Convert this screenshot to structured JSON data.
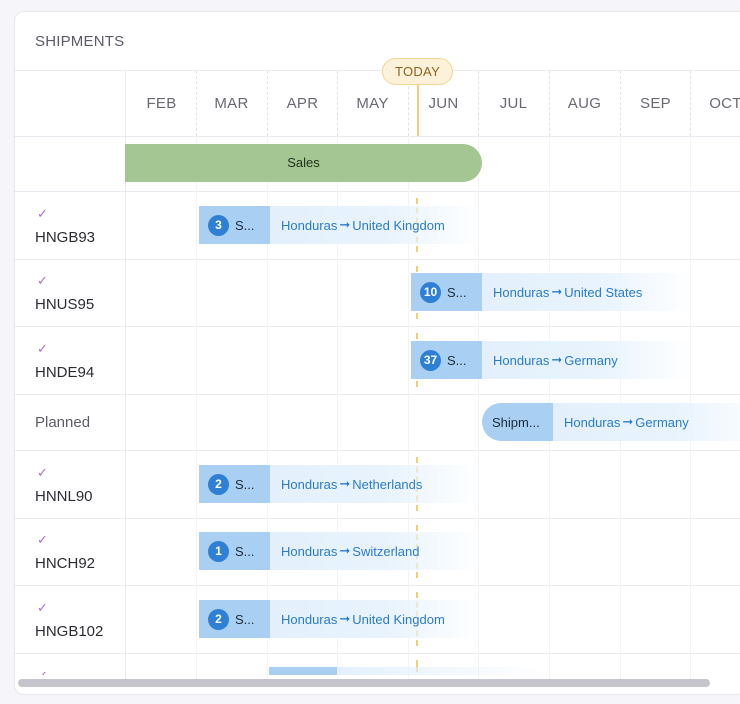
{
  "card": {
    "title": "SHIPMENTS"
  },
  "months": [
    "FEB",
    "MAR",
    "APR",
    "MAY",
    "JUN",
    "JUL",
    "AUG",
    "SEP",
    "OCT"
  ],
  "today_label": "TODAY",
  "sales_bar": {
    "label": "Sales",
    "color": "#a3c693"
  },
  "rows": [
    {
      "label": "HNGB93",
      "checked": true,
      "badge": "3",
      "short": "S...",
      "route_from": "Honduras",
      "arrow": "➞",
      "route_to": "United Kingdom"
    },
    {
      "label": "HNUS95",
      "checked": true,
      "badge": "10",
      "short": "S...",
      "route_from": "Honduras",
      "arrow": "➞",
      "route_to": "United States"
    },
    {
      "label": "HNDE94",
      "checked": true,
      "badge": "37",
      "short": "S...",
      "route_from": "Honduras",
      "arrow": "➞",
      "route_to": "Germany"
    },
    {
      "label": "Planned",
      "checked": false,
      "short": "Shipm...",
      "route_from": "Honduras",
      "arrow": "➞",
      "route_to": "Germany"
    },
    {
      "label": "HNNL90",
      "checked": true,
      "badge": "2",
      "short": "S...",
      "route_from": "Honduras",
      "arrow": "➞",
      "route_to": "Netherlands"
    },
    {
      "label": "HNCH92",
      "checked": true,
      "badge": "1",
      "short": "S...",
      "route_from": "Honduras",
      "arrow": "➞",
      "route_to": "Switzerland"
    },
    {
      "label": "HNGB102",
      "checked": true,
      "badge": "2",
      "short": "S...",
      "route_from": "Honduras",
      "arrow": "➞",
      "route_to": "United Kingdom"
    }
  ],
  "icons": {
    "check": "checkmark-icon",
    "arrow": "right-arrow-icon"
  },
  "colors": {
    "accent": "#2f80d4",
    "today": "#f2cf74",
    "shipment": "#a9cff3",
    "check": "#b06ad6"
  }
}
